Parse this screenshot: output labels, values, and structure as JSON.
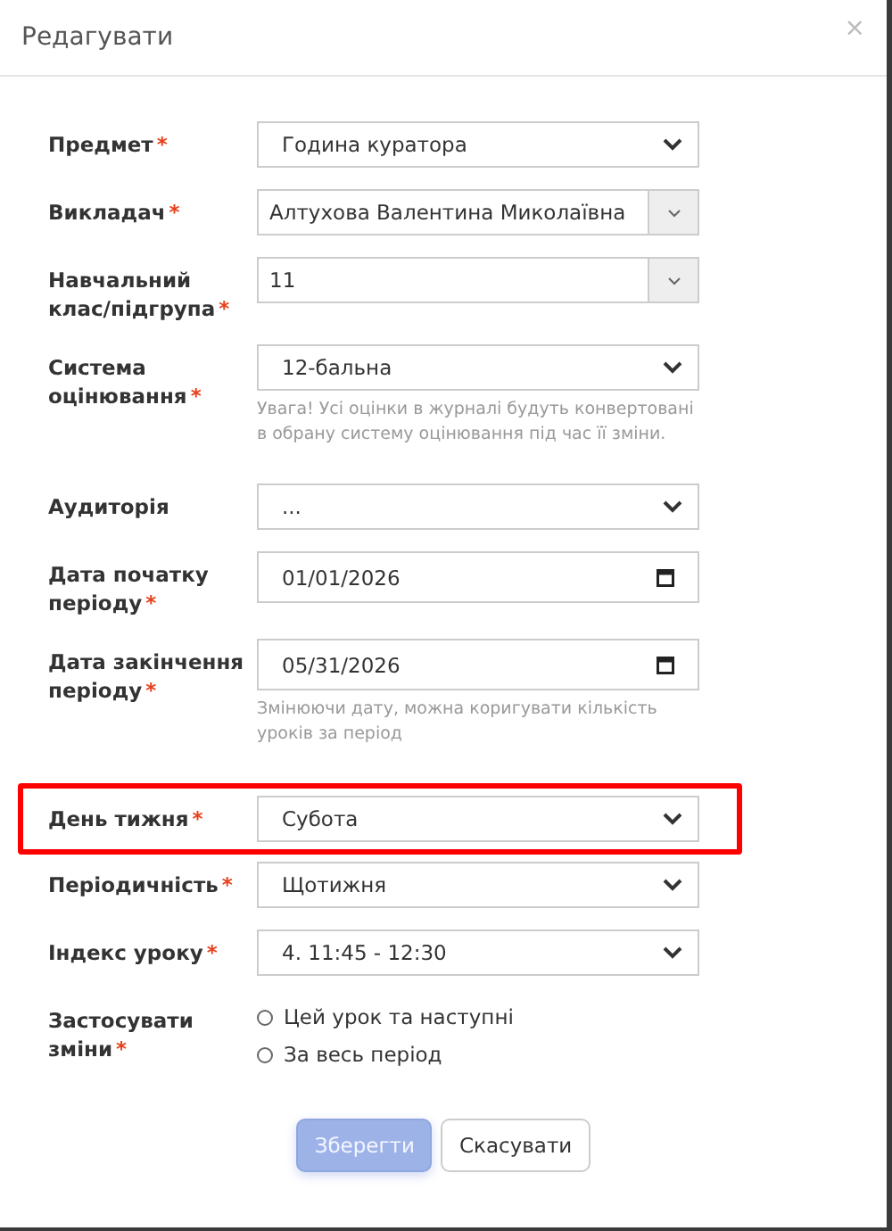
{
  "dialog": {
    "title": "Редагувати",
    "close": "×"
  },
  "fields": [
    {
      "kind": "select",
      "label": "Предмет",
      "required_mark": "*",
      "value": "Година куратора",
      "highlighted": false
    },
    {
      "kind": "combo",
      "label": "Викладач",
      "required_mark": "*",
      "value": "Алтухова Валентина Миколаївна",
      "highlighted": false
    },
    {
      "kind": "combo",
      "label": "Навчальний клас/підгрупа",
      "required_mark": "*",
      "value": "11",
      "highlighted": false
    },
    {
      "kind": "select",
      "label": "Система оцінювання",
      "required_mark": "*",
      "value": "12-бальна",
      "hint": "Увага! Усі оцінки в журналі будуть конвертовані в обрану систему оцінювання під час її зміни.",
      "highlighted": false
    },
    {
      "kind": "select",
      "label": "Аудиторія",
      "value": "...",
      "highlighted": false
    },
    {
      "kind": "date",
      "label": "Дата початку періоду",
      "required_mark": "*",
      "value": "01/01/2026",
      "highlighted": false
    },
    {
      "kind": "date",
      "label": "Дата закінчення періоду",
      "required_mark": "*",
      "value": "05/31/2026",
      "hint": "Змінюючи дату, можна коригувати кількість уроків за період",
      "highlighted": false
    },
    {
      "kind": "select",
      "label": "День тижня",
      "required_mark": "*",
      "value": "Субота",
      "highlighted": true
    },
    {
      "kind": "select",
      "label": "Періодичність",
      "required_mark": "*",
      "value": "Щотижня",
      "highlighted": false
    },
    {
      "kind": "select",
      "label": "Індекс уроку",
      "required_mark": "*",
      "value": "4. 11:45 - 12:30",
      "highlighted": false
    },
    {
      "kind": "radio",
      "label": "Застосувати зміни",
      "required_mark": "*",
      "highlighted": false,
      "options": [
        {
          "label": "Цей урок та наступні",
          "selected": false
        },
        {
          "label": "За весь період",
          "selected": false
        }
      ]
    }
  ],
  "buttons": [
    {
      "kind": "primary",
      "label": "Зберегти",
      "disabled": true
    },
    {
      "kind": "secondary",
      "label": "Скасувати",
      "disabled": false
    }
  ]
}
